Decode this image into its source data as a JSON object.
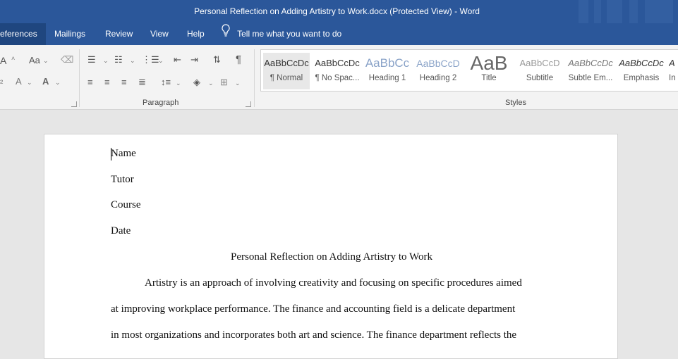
{
  "window": {
    "title": "Personal Reflection on Adding Artistry to Work.docx (Protected View)  -  Word"
  },
  "tabs": [
    {
      "label": "eferences",
      "active": true
    },
    {
      "label": "Mailings"
    },
    {
      "label": "Review"
    },
    {
      "label": "View"
    },
    {
      "label": "Help"
    }
  ],
  "tellme": {
    "placeholder": "Tell me what you want to do",
    "icon": "lightbulb-icon"
  },
  "ribbon": {
    "font_glyphs": {
      "grow": "A",
      "case": "Aa",
      "highlight": "A",
      "color": "A"
    },
    "paragraph_label": "Paragraph",
    "pilcrow": "¶",
    "styles_label": "Styles",
    "styles": [
      {
        "sample": "AaBbCcDc",
        "name": "¶ Normal"
      },
      {
        "sample": "AaBbCcDc",
        "name": "¶ No Spac..."
      },
      {
        "sample": "AaBbCc",
        "name": "Heading 1"
      },
      {
        "sample": "AaBbCcD",
        "name": "Heading 2"
      },
      {
        "sample": "AaB",
        "name": "Title"
      },
      {
        "sample": "AaBbCcD",
        "name": "Subtitle"
      },
      {
        "sample": "AaBbCcDc",
        "name": "Subtle Em..."
      },
      {
        "sample": "AaBbCcDc",
        "name": "Emphasis"
      },
      {
        "sample": "A",
        "name": "In"
      }
    ]
  },
  "document": {
    "name_line": "Name",
    "tutor_line": "Tutor",
    "course_line": "Course",
    "date_line": "Date",
    "heading": "Personal Reflection on Adding Artistry to Work",
    "para_line1": "Artistry is an approach of involving creativity and focusing on specific procedures aimed",
    "para_line2": "at improving workplace performance. The finance and accounting field is a delicate department",
    "para_line3": "in most organizations and incorporates both art and science. The finance department reflects the"
  },
  "colors": {
    "title_bar": "#2b579a",
    "active_tab": "#1f467f",
    "ribbon_bg": "#f3f3f3",
    "canvas": "#e6e6e6"
  }
}
